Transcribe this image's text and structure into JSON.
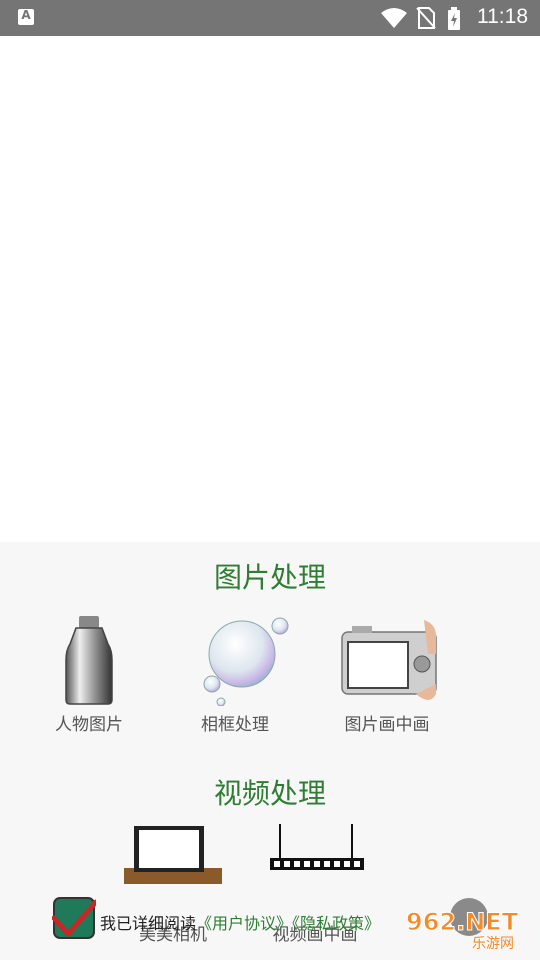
{
  "status_bar": {
    "time": "11:18",
    "notification_icon": "a-icon",
    "icons": [
      "wifi-icon",
      "no-sim-icon",
      "battery-charging-icon"
    ]
  },
  "sections": [
    {
      "title": "图片处理",
      "items": [
        {
          "label": "人物图片",
          "icon": "bottle-image"
        },
        {
          "label": "相框处理",
          "icon": "bubble-image"
        },
        {
          "label": "图片画中画",
          "icon": "camera-image"
        }
      ]
    },
    {
      "title": "视频处理",
      "items": [
        {
          "label": "美美相机",
          "icon": "frame-image"
        },
        {
          "label": "视频画中画",
          "icon": "filmstrip-image"
        }
      ]
    }
  ],
  "agreement": {
    "prefix": "我已详细阅读",
    "user_agreement": "《用户协议》",
    "privacy_policy": "《隐私政策》"
  },
  "watermark": {
    "brand": "962.NET",
    "sub": "乐游网"
  },
  "colors": {
    "status_bar": "#757575",
    "accent_green": "#2e7d32",
    "panel_bg": "#f7f7f7"
  }
}
